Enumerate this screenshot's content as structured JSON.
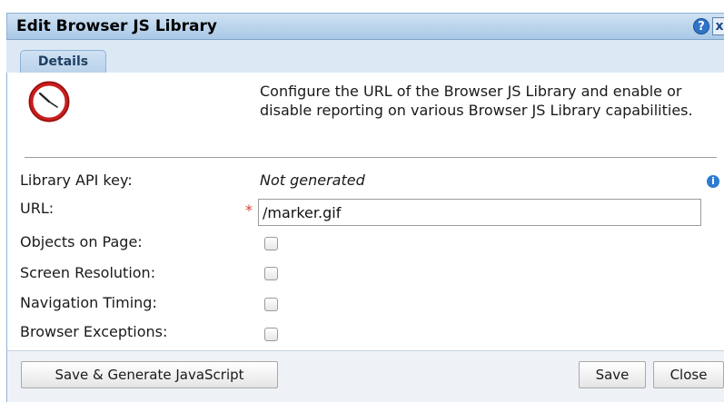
{
  "dialog": {
    "title": "Edit Browser JS Library",
    "help_glyph": "?",
    "close_glyph": "x",
    "icon": "clock-icon"
  },
  "tabs": [
    {
      "label": "Details",
      "active": true
    }
  ],
  "description": "Configure the URL of the Browser JS Library and enable or disable reporting on various Browser JS Library capabilities.",
  "fields": {
    "api_key": {
      "label": "Library API key:",
      "value": "Not generated"
    },
    "url": {
      "label": "URL:",
      "required_mark": "*",
      "value": "/marker.gif"
    },
    "objects_on_page": {
      "label": "Objects on Page:",
      "checked": false
    },
    "screen_resolution": {
      "label": "Screen Resolution:",
      "checked": false
    },
    "navigation_timing": {
      "label": "Navigation Timing:",
      "checked": false
    },
    "browser_exceptions": {
      "label": "Browser Exceptions:",
      "checked": false
    }
  },
  "info_glyph": "i",
  "buttons": {
    "save_generate": "Save & Generate JavaScript",
    "save": "Save",
    "close": "Close"
  },
  "colors": {
    "titlebar": "#a9c8e6",
    "help_button": "#2f74c8",
    "required": "#d83a2a",
    "clock_ring": "#c81e1e"
  }
}
